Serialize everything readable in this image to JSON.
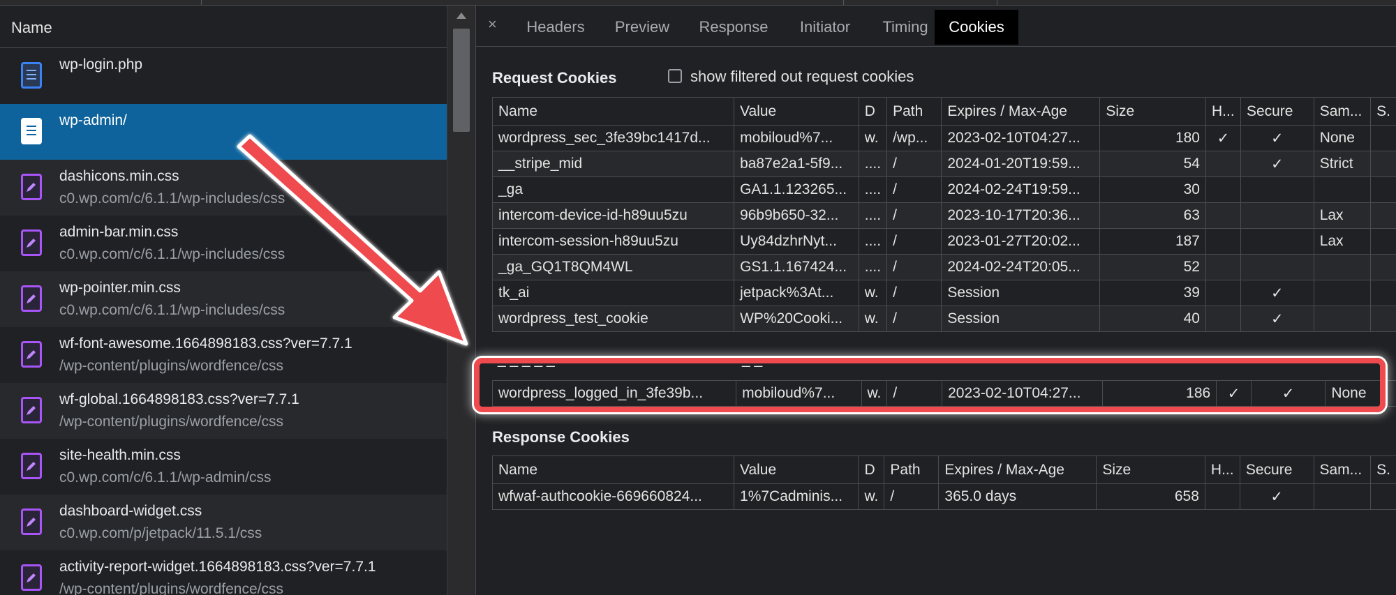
{
  "left_panel": {
    "header": "Name",
    "files": [
      {
        "name": "wp-login.php",
        "path": "",
        "type": "doc"
      },
      {
        "name": "wp-admin/",
        "path": "",
        "type": "doc",
        "selected": true
      },
      {
        "name": "dashicons.min.css",
        "path": "c0.wp.com/c/6.1.1/wp-includes/css",
        "type": "css"
      },
      {
        "name": "admin-bar.min.css",
        "path": "c0.wp.com/c/6.1.1/wp-includes/css",
        "type": "css"
      },
      {
        "name": "wp-pointer.min.css",
        "path": "c0.wp.com/c/6.1.1/wp-includes/css",
        "type": "css"
      },
      {
        "name": "wf-font-awesome.1664898183.css?ver=7.7.1",
        "path": "/wp-content/plugins/wordfence/css",
        "type": "css"
      },
      {
        "name": "wf-global.1664898183.css?ver=7.7.1",
        "path": "/wp-content/plugins/wordfence/css",
        "type": "css"
      },
      {
        "name": "site-health.min.css",
        "path": "c0.wp.com/c/6.1.1/wp-admin/css",
        "type": "css"
      },
      {
        "name": "dashboard-widget.css",
        "path": "c0.wp.com/p/jetpack/11.5.1/css",
        "type": "css"
      },
      {
        "name": "activity-report-widget.1664898183.css?ver=7.7.1",
        "path": "/wp-content/plugins/wordfence/css",
        "type": "css"
      }
    ]
  },
  "tabs": {
    "close": "×",
    "items": [
      "Headers",
      "Preview",
      "Response",
      "Initiator",
      "Timing",
      "Cookies"
    ],
    "active": "Cookies"
  },
  "request_cookies": {
    "title": "Request Cookies",
    "filter_label": "show filtered out request cookies",
    "filter_checked": false,
    "columns": [
      "Name",
      "Value",
      "D",
      "Path",
      "Expires / Max-Age",
      "Size",
      "H...",
      "Secure",
      "Sam...",
      "S."
    ],
    "rows": [
      [
        "wordpress_sec_3fe39bc1417d...",
        "mobiloud%7...",
        "w.",
        "/wp...",
        "2023-02-10T04:27...",
        "180",
        "✓",
        "✓",
        "None",
        ""
      ],
      [
        "__stripe_mid",
        "ba87e2a1-5f9...",
        "....",
        "/",
        "2024-01-20T19:59...",
        "54",
        "",
        "✓",
        "Strict",
        ""
      ],
      [
        "_ga",
        "GA1.1.123265...",
        "....",
        "/",
        "2024-02-24T19:59...",
        "30",
        "",
        "",
        "",
        ""
      ],
      [
        "intercom-device-id-h89uu5zu",
        "96b9b650-32...",
        "....",
        "/",
        "2023-10-17T20:36...",
        "63",
        "",
        "",
        "Lax",
        ""
      ],
      [
        "intercom-session-h89uu5zu",
        "Uy84dzhrNyt...",
        "....",
        "/",
        "2023-01-27T20:02...",
        "187",
        "",
        "",
        "Lax",
        ""
      ],
      [
        "_ga_GQ1T8QM4WL",
        "GS1.1.167424...",
        "....",
        "/",
        "2024-02-24T20:05...",
        "52",
        "",
        "",
        "",
        ""
      ],
      [
        "tk_ai",
        "jetpack%3At...",
        "w.",
        "/",
        "Session",
        "39",
        "",
        "✓",
        "",
        ""
      ],
      [
        "wordpress_test_cookie",
        "WP%20Cooki...",
        "w.",
        "/",
        "Session",
        "40",
        "",
        "✓",
        "",
        ""
      ]
    ],
    "highlighted_row": [
      "wordpress_logged_in_3fe39b...",
      "mobiloud%7...",
      "w.",
      "/",
      "2023-02-10T04:27...",
      "186",
      "✓",
      "✓",
      "None",
      ""
    ]
  },
  "response_cookies": {
    "title": "Response Cookies",
    "columns": [
      "Name",
      "Value",
      "D",
      "Path",
      "Expires / Max-Age",
      "Size",
      "H...",
      "Secure",
      "Sam...",
      "S."
    ],
    "rows": [
      [
        "wfwaf-authcookie-669660824...",
        "1%7Cadminis...",
        "w.",
        "/",
        "365.0 days",
        "658",
        "",
        "✓",
        "",
        ""
      ]
    ]
  },
  "annotation": {
    "arrow_color": "#ef4b4f",
    "box_color": "#ef4b4f"
  }
}
